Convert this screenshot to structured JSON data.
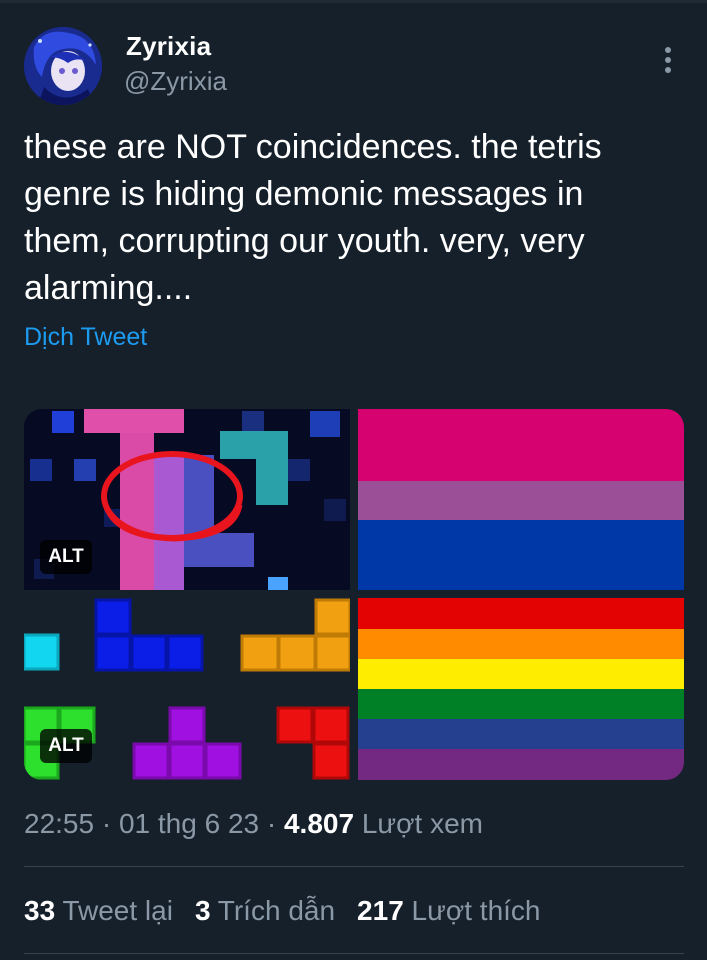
{
  "author": {
    "name": "Zyrixia",
    "handle": "@Zyrixia"
  },
  "tweet": {
    "text": "these are NOT coincidences. the tetris genre is hiding demonic messages in them, corrupting our youth. very, very alarming....",
    "translate_label": "Dịch Tweet"
  },
  "media": {
    "alt_label": "ALT",
    "flag_bi_colors": [
      "#d60270",
      "#9b4f96",
      "#0038a8"
    ],
    "flag_rainbow_colors": [
      "#e40303",
      "#ff8c00",
      "#ffed00",
      "#008026",
      "#24408e",
      "#732982"
    ]
  },
  "meta": {
    "time": "22:55",
    "date": "01 thg 6 23",
    "views_count": "4.807",
    "views_label": "Lượt xem"
  },
  "stats": {
    "retweets_count": "33",
    "retweets_label": "Tweet lại",
    "quotes_count": "3",
    "quotes_label": "Trích dẫn",
    "likes_count": "217",
    "likes_label": "Lượt thích"
  },
  "colors": {
    "background": "#15202b",
    "link": "#1d9bf0",
    "secondary_text": "#8b98a5"
  },
  "icons": [
    "more-icon",
    "avatar"
  ]
}
